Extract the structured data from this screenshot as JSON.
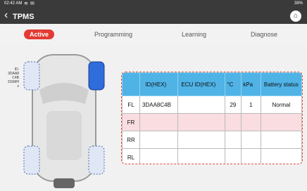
{
  "status": {
    "time": "02:42 AM",
    "battery": "38%"
  },
  "app": {
    "title": "TPMS"
  },
  "tabs": [
    {
      "label": "Active",
      "active": true
    },
    {
      "label": "Programming",
      "active": false
    },
    {
      "label": "Learning",
      "active": false
    },
    {
      "label": "Diagnose",
      "active": false
    }
  ],
  "sensor_info": {
    "line1": "ID:",
    "line2": "3DAA8",
    "line3": "C4B",
    "line4": "315MH",
    "line5": "z"
  },
  "table": {
    "headers": [
      "",
      "ID(HEX)",
      "ECU ID(HEX)",
      "°C",
      "kPa",
      "Battery status"
    ],
    "rows": [
      {
        "pos": "FL",
        "id": "3DAA8C4B",
        "ecu": "",
        "temp": "29",
        "kpa": "1",
        "battery": "Normal"
      },
      {
        "pos": "FR",
        "id": "",
        "ecu": "",
        "temp": "",
        "kpa": "",
        "battery": ""
      },
      {
        "pos": "RR",
        "id": "",
        "ecu": "",
        "temp": "",
        "kpa": "",
        "battery": ""
      },
      {
        "pos": "RL",
        "id": "",
        "ecu": "",
        "temp": "",
        "kpa": "",
        "battery": ""
      }
    ]
  },
  "colors": {
    "accent": "#e23b33",
    "header": "#4fb3e6",
    "highlight_row": "#f9dde0"
  }
}
